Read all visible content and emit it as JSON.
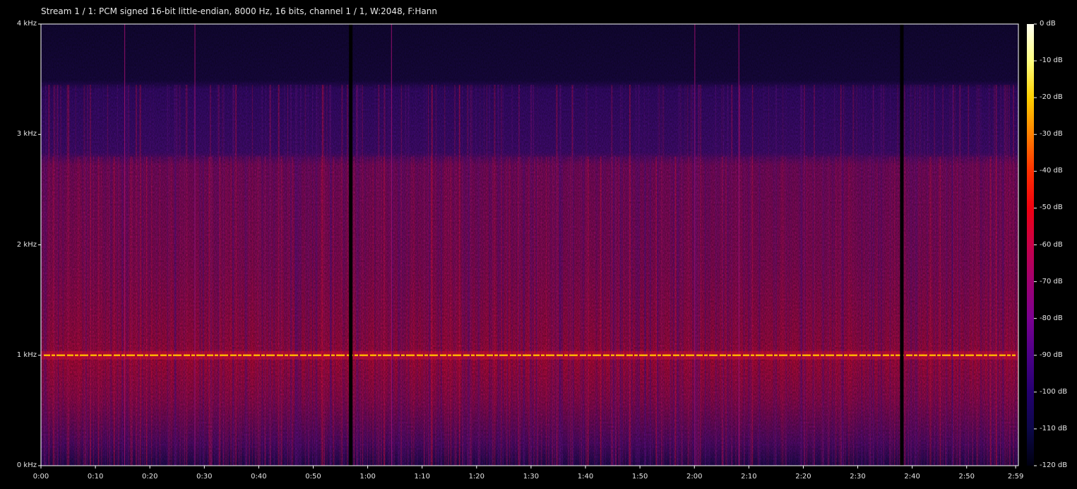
{
  "title": "Stream 1 / 1: PCM signed 16-bit little-endian, 8000 Hz, 16 bits, channel 1 / 1, W:2048, F:Hann",
  "chart_data": {
    "type": "heatmap",
    "title": "Stream 1 / 1: PCM signed 16-bit little-endian, 8000 Hz, 16 bits, channel 1 / 1, W:2048, F:Hann",
    "x_axis": {
      "unit": "seconds",
      "range": [
        0,
        179.5
      ],
      "ticks": [
        {
          "value": 0,
          "label": "0:00"
        },
        {
          "value": 10,
          "label": "0:10"
        },
        {
          "value": 20,
          "label": "0:20"
        },
        {
          "value": 30,
          "label": "0:30"
        },
        {
          "value": 40,
          "label": "0:40"
        },
        {
          "value": 50,
          "label": "0:50"
        },
        {
          "value": 60,
          "label": "1:00"
        },
        {
          "value": 70,
          "label": "1:10"
        },
        {
          "value": 80,
          "label": "1:20"
        },
        {
          "value": 90,
          "label": "1:30"
        },
        {
          "value": 100,
          "label": "1:40"
        },
        {
          "value": 110,
          "label": "1:50"
        },
        {
          "value": 120,
          "label": "2:00"
        },
        {
          "value": 130,
          "label": "2:10"
        },
        {
          "value": 140,
          "label": "2:20"
        },
        {
          "value": 150,
          "label": "2:30"
        },
        {
          "value": 160,
          "label": "2:40"
        },
        {
          "value": 170,
          "label": "2:50"
        },
        {
          "value": 179,
          "label": "2:59"
        }
      ]
    },
    "y_axis": {
      "unit": "kHz",
      "range": [
        0,
        4
      ],
      "ticks": [
        {
          "value": 0,
          "label": "0 kHz"
        },
        {
          "value": 1,
          "label": "1 kHz"
        },
        {
          "value": 2,
          "label": "2 kHz"
        },
        {
          "value": 3,
          "label": "3 kHz"
        },
        {
          "value": 4,
          "label": "4 kHz"
        }
      ]
    },
    "colorbar": {
      "unit": "dB",
      "range": [
        -120,
        0
      ],
      "ticks": [
        "0 dB",
        "-10 dB",
        "-20 dB",
        "-30 dB",
        "-40 dB",
        "-50 dB",
        "-60 dB",
        "-70 dB",
        "-80 dB",
        "-90 dB",
        "-100 dB",
        "-110 dB",
        "-120 dB"
      ],
      "colors": [
        "#fffff0",
        "#ffff80",
        "#ffd000",
        "#ff8000",
        "#ff3000",
        "#f00010",
        "#c80048",
        "#a00070",
        "#7a0090",
        "#4c0088",
        "#240070",
        "#0c0848",
        "#000010"
      ]
    },
    "features": {
      "tone_frequency_khz": 1.0,
      "tone_level_db": -30,
      "band_edges_khz": [
        2.8,
        3.45
      ],
      "silent_gaps_s": [
        56.7,
        157.9
      ],
      "narrow_lines_s": [
        15.3,
        28.2,
        64.3,
        120.0,
        128.1
      ]
    }
  }
}
